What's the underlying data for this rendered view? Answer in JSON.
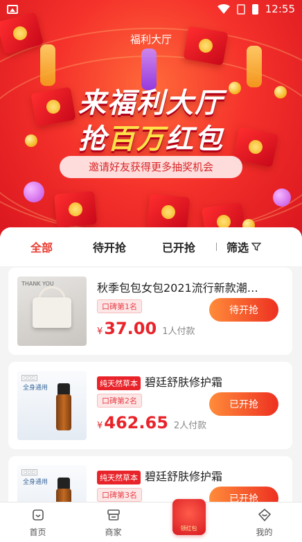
{
  "status_bar": {
    "time": "12:55"
  },
  "hero": {
    "title": "福利大厅",
    "slogan_line1": "来福利大厅",
    "slogan_line2_pre": "抢",
    "slogan_line2_highlight": "百万",
    "slogan_line2_post": "红包",
    "invite_text": "邀请好友获得更多抽奖机会"
  },
  "tabs": {
    "items": [
      {
        "label": "全部",
        "active": true
      },
      {
        "label": "待开抢",
        "active": false
      },
      {
        "label": "已开抢",
        "active": false
      }
    ],
    "filter_label": "筛选"
  },
  "products": [
    {
      "badge": "",
      "title": "秋季包包女包2021流行新款潮…",
      "rank": "口碑第1名",
      "currency": "¥",
      "price": "37.00",
      "paid": "1人付款",
      "button": "待开抢",
      "thumb_caption": "THANK YOU"
    },
    {
      "badge": "纯天然草本",
      "title": "碧廷舒肤修护霜",
      "rank": "口碑第2名",
      "currency": "¥",
      "price": "462.65",
      "paid": "2人付款",
      "button": "已开抢",
      "thumb_caption": "全身通用"
    },
    {
      "badge": "纯天然草本",
      "title": "碧廷舒肤修护霜",
      "rank": "口碑第3名",
      "currency": "¥",
      "price": "",
      "paid": "",
      "button": "已开抢",
      "thumb_caption": "全身通用"
    }
  ],
  "bottom_nav": {
    "items": [
      {
        "label": "首页",
        "icon": "home-icon"
      },
      {
        "label": "商家",
        "icon": "store-icon"
      },
      {
        "label": "",
        "icon": "red-packet-icon",
        "badge_text": "领红包"
      },
      {
        "label": "我的",
        "icon": "profile-icon"
      }
    ]
  },
  "colors": {
    "accent": "#e8242a",
    "button_start": "#ff8c3a",
    "button_end": "#ed3021"
  }
}
